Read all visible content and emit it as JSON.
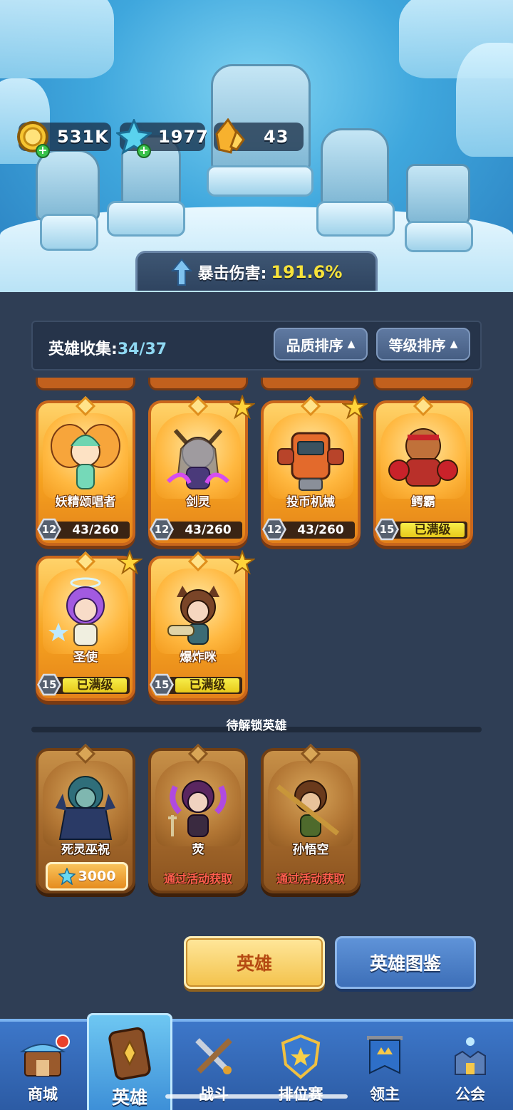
{
  "resources": [
    {
      "name": "gold",
      "icon": "gold-coin-icon",
      "value": "531K",
      "addable": true
    },
    {
      "name": "gem",
      "icon": "blue-crystal-icon",
      "value": "1977",
      "addable": true
    },
    {
      "name": "shard",
      "icon": "orange-crystal-icon",
      "value": "43",
      "addable": false
    }
  ],
  "crit_bonus": {
    "label": "暴击伤害:",
    "value": "191.6%"
  },
  "collection": {
    "title": "英雄收集:",
    "count": "34/37",
    "sort_quality": "品质排序",
    "sort_level": "等级排序"
  },
  "heroes": [
    {
      "name": "妖精颂唱者",
      "level": "12",
      "progress": "43/260",
      "maxed": false,
      "star": false
    },
    {
      "name": "剑灵",
      "level": "12",
      "progress": "43/260",
      "maxed": false,
      "star": true
    },
    {
      "name": "投币机械",
      "level": "12",
      "progress": "43/260",
      "maxed": false,
      "star": true
    },
    {
      "name": "鳄霸",
      "level": "15",
      "progress": "已满级",
      "maxed": true,
      "star": false
    },
    {
      "name": "圣使",
      "level": "15",
      "progress": "已满级",
      "maxed": true,
      "star": true
    },
    {
      "name": "爆炸咪",
      "level": "15",
      "progress": "已满级",
      "maxed": true,
      "star": true
    }
  ],
  "locked_section_title": "待解锁英雄",
  "locked_heroes": [
    {
      "name": "死灵巫祝",
      "cost": "3000",
      "unlock_text": ""
    },
    {
      "name": "荧",
      "cost": "",
      "unlock_text": "通过活动获取"
    },
    {
      "name": "孙悟空",
      "cost": "",
      "unlock_text": "通过活动获取"
    }
  ],
  "buttons": {
    "hero": "英雄",
    "codex": "英雄图鉴"
  },
  "nav": [
    {
      "label": "商城",
      "icon": "shop-icon",
      "active": false
    },
    {
      "label": "英雄",
      "icon": "hero-card-icon",
      "active": true
    },
    {
      "label": "战斗",
      "icon": "crossed-swords-icon",
      "active": false
    },
    {
      "label": "排位赛",
      "icon": "ranked-shield-icon",
      "active": false
    },
    {
      "label": "领主",
      "icon": "lord-banner-icon",
      "active": false
    },
    {
      "label": "公会",
      "icon": "guild-castle-icon",
      "active": false
    }
  ],
  "colors": {
    "accent_yellow": "#f7e23a",
    "count_cyan": "#8fd8f2",
    "unlock_red": "#ff5e4f",
    "nav_blue": "#3d77c9"
  }
}
